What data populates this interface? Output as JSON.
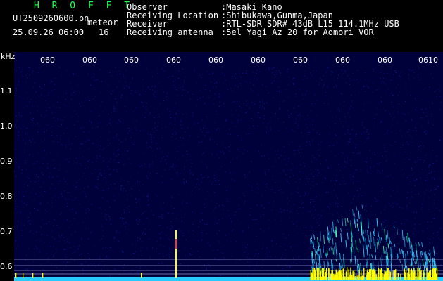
{
  "header": {
    "brand": "H R O F F T",
    "filename": "UT2509260600.pn",
    "kind": "meteor",
    "date_time": "25.09.26 06:00",
    "count": "16",
    "info": [
      {
        "label": "Observer",
        "value": ":Masaki Kano"
      },
      {
        "label": "Receiving Location",
        "value": ":Shibukawa,Gunma,Japan"
      },
      {
        "label": "Receiver",
        "value": ":RTL-SDR SDR# 43dB L15 114.1MHz USB"
      },
      {
        "label": "Receiving antenna",
        "value": ":5el Yagi Az 20 for Aomori VOR"
      }
    ]
  },
  "plot": {
    "y_unit": "kHz",
    "y_ticks": [
      "1.1",
      "1.0",
      "0.9",
      "0.8",
      "0.7",
      "0.6"
    ],
    "x_ticks": [
      "060",
      "060",
      "060",
      "060",
      "060",
      "060",
      "060",
      "060",
      "060",
      "0610"
    ],
    "colors": {
      "background": "#00003a",
      "noise": "#0a1a8a",
      "signal": "#27c9ff",
      "strong": "#ffff00",
      "hot": "#ff3030",
      "hline": "#c0c0ff"
    }
  }
}
